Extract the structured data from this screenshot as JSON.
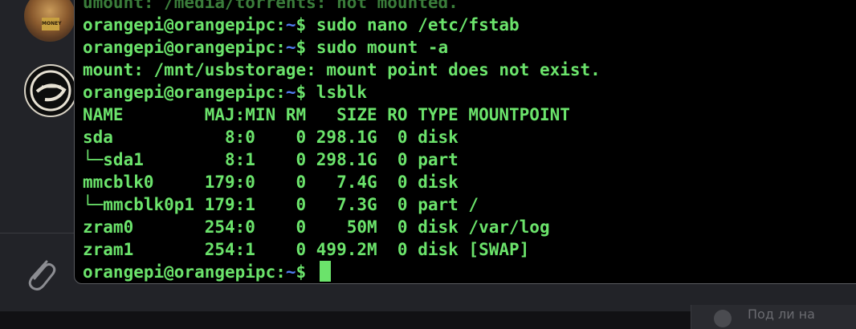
{
  "terminal": {
    "prompt": {
      "user_host": "orangepi@orangepipc",
      "sep": ":",
      "path": "~",
      "symbol": "$"
    },
    "lines": [
      {
        "type": "output",
        "text": "umount: /media/torrents: not mounted."
      },
      {
        "type": "command",
        "cmd": "sudo nano /etc/fstab"
      },
      {
        "type": "command",
        "cmd": "sudo mount -a"
      },
      {
        "type": "output",
        "text": "mount: /mnt/usbstorage: mount point does not exist."
      },
      {
        "type": "command",
        "cmd": "lsblk"
      },
      {
        "type": "output",
        "text": "NAME        MAJ:MIN RM   SIZE RO TYPE MOUNTPOINT"
      },
      {
        "type": "output",
        "text": "sda           8:0    0 298.1G  0 disk "
      },
      {
        "type": "output",
        "text": "└─sda1        8:1    0 298.1G  0 part "
      },
      {
        "type": "output",
        "text": "mmcblk0     179:0    0   7.4G  0 disk "
      },
      {
        "type": "output",
        "text": "└─mmcblk0p1 179:1    0   7.3G  0 part /"
      },
      {
        "type": "output",
        "text": "zram0       254:0    0    50M  0 disk /var/log"
      },
      {
        "type": "output",
        "text": "zram1       254:1    0 499.2M  0 disk [SWAP]"
      },
      {
        "type": "prompt_current"
      }
    ]
  },
  "chat": {
    "avatar_label": "MONEY",
    "bottom_panel_text": "Под ли на"
  },
  "colors": {
    "prompt_green": "#6be36b",
    "tilde_blue": "#4f7cf0",
    "terminal_bg": "#000000"
  },
  "icons": [
    "paperclip-icon",
    "avatar-image"
  ]
}
